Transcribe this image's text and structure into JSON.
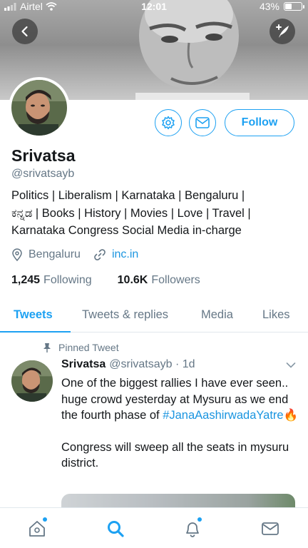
{
  "status_bar": {
    "carrier": "Airtel",
    "time": "12:01",
    "battery": "43%",
    "battery_level": 0.43
  },
  "header": {
    "back_icon": "chevron-left-icon",
    "compose_icon": "compose-tweet-icon"
  },
  "profile": {
    "name": "Srivatsa",
    "handle": "@srivatsayb",
    "bio_lines": [
      "Politics | Liberalism | Karnataka | Bengaluru |",
      "ಕನ್ನಡ | Books | History | Movies | Love | Travel |",
      "Karnataka Congress Social Media in-charge"
    ],
    "location": "Bengaluru",
    "url": "inc.in",
    "following_count": "1,245",
    "following_label": "Following",
    "followers_count": "10.6K",
    "followers_label": "Followers",
    "follow_label": "Follow"
  },
  "tabs": [
    "Tweets",
    "Tweets & replies",
    "Media",
    "Likes"
  ],
  "tweet": {
    "pinned_label": "Pinned Tweet",
    "author": "Srivatsa",
    "handle_time": "@srivatsayb · 1d",
    "text_1": "One of the biggest rallies I have ever seen.. huge crowd yesterday at Mysuru as we end the fourth phase of",
    "hashtag": "#JanaAashirwadaYatre",
    "emoji": "🔥",
    "text_2": "Congress will sweep all the seats in mysuru district."
  },
  "colors": {
    "accent": "#1da1f2",
    "link": "#1b95e0",
    "secondary_text": "#657786"
  }
}
